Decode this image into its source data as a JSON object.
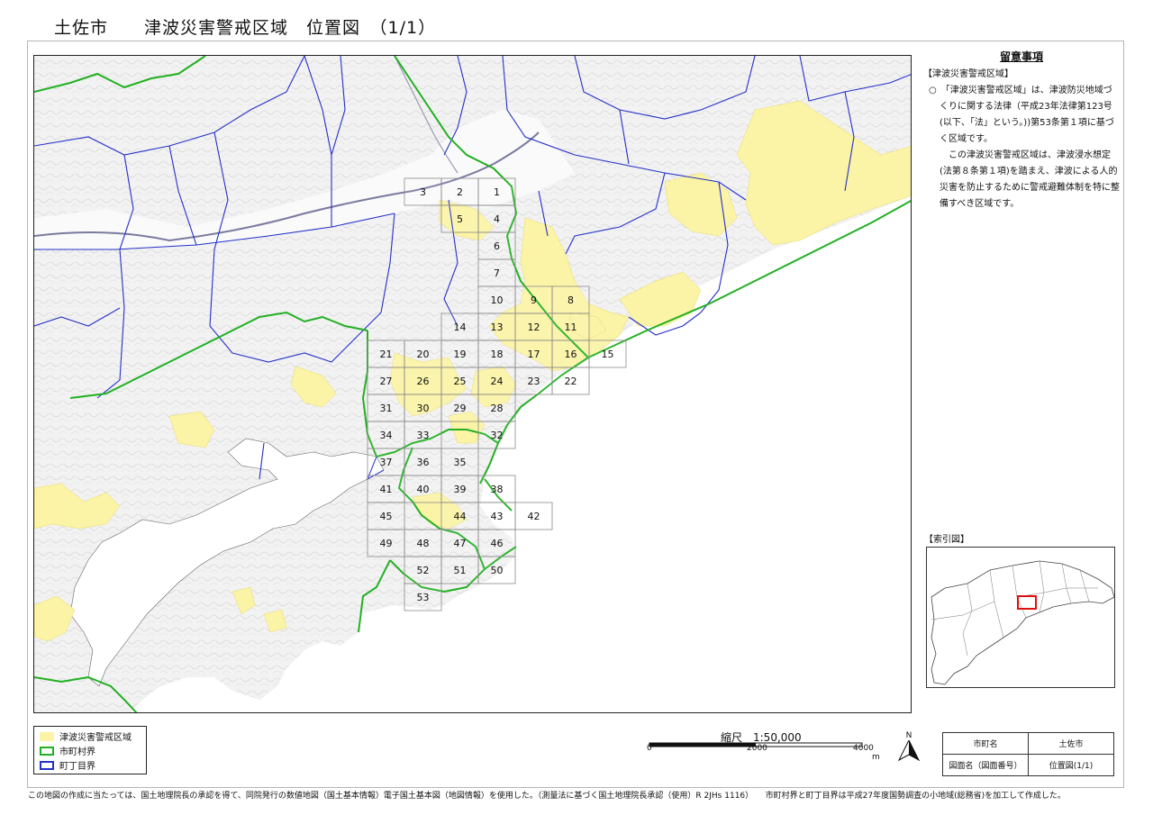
{
  "title": "土佐市　　津波災害警戒区域　位置図　（1/1）",
  "notes": {
    "heading": "留意事項",
    "subheading": "【津波災害警戒区域】",
    "para1": "○　「津波災害警戒区域」は、津波防災地域づくりに関する法律（平成23年法律第123号(以下、「法」という。))第53条第１項に基づく区域です。",
    "para2": "この津波災害警戒区域は、津波浸水想定(法第８条第１項)を踏まえ、津波による人的災害を防止するために警戒避難体制を特に整備すべき区域です。"
  },
  "index_map": {
    "title": "【索引図】"
  },
  "legend": {
    "items": [
      {
        "label": "津波災害警戒区域",
        "color": "#fbf3a6"
      },
      {
        "label": "市町村界",
        "color": "#22b022"
      },
      {
        "label": "町丁目界",
        "color": "#2430c8"
      }
    ]
  },
  "scale": {
    "title": "縮尺　1:50,000",
    "ticks": [
      "0",
      "2000",
      "4000"
    ],
    "unit": "m"
  },
  "north_label": "N",
  "info_table": {
    "row1": {
      "label": "市町名",
      "value": "土佐市"
    },
    "row2": {
      "label": "図面名（図面番号）",
      "value": "位置図(1/1)"
    }
  },
  "footer": "この地図の作成に当たっては、国土地理院長の承認を得て、同院発行の数値地図（国土基本情報）電子国土基本図（地図情報）を使用した。（測量法に基づく国土地理院長承認（使用）R 2JHs 1116）　　市町村界と町丁目界は平成27年度国勢調査の小地域(総務省)を加工して作成した。",
  "colors": {
    "tsunami_zone": "#fbf3a6",
    "municipal_boundary": "#22b022",
    "town_boundary": "#2430c8",
    "index_highlight": "#e01010"
  },
  "grid_sheets": [
    "1",
    "2",
    "3",
    "4",
    "5",
    "6",
    "7",
    "8",
    "9",
    "10",
    "11",
    "12",
    "13",
    "14",
    "15",
    "16",
    "17",
    "18",
    "19",
    "20",
    "21",
    "22",
    "23",
    "24",
    "25",
    "26",
    "27",
    "28",
    "29",
    "30",
    "31",
    "32",
    "33",
    "34",
    "35",
    "36",
    "37",
    "38",
    "39",
    "40",
    "41",
    "42",
    "43",
    "44",
    "45",
    "46",
    "47",
    "48",
    "49",
    "50",
    "51",
    "52",
    "53"
  ]
}
